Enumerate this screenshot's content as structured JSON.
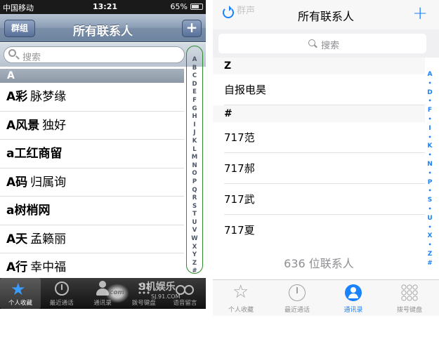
{
  "left_phone": {
    "status": {
      "carrier": "中国移动",
      "time": "13:21",
      "battery": "65%"
    },
    "nav": {
      "title": "所有联系人",
      "group_button": "群组",
      "add_button": "+"
    },
    "search": {
      "placeholder": "搜索"
    },
    "section_header": "A",
    "contacts": [
      {
        "first": "A彩",
        "last": "脉梦缘"
      },
      {
        "first": "A风景",
        "last": "独好"
      },
      {
        "first": "a工红商留",
        "last": ""
      },
      {
        "first": "A码",
        "last": "归属询"
      },
      {
        "first": "a树梢网",
        "last": ""
      },
      {
        "first": "A天",
        "last": "孟籁丽"
      },
      {
        "first": "A行",
        "last": "幸中福"
      }
    ],
    "index_letters": [
      "A",
      "B",
      "C",
      "D",
      "E",
      "F",
      "G",
      "H",
      "I",
      "J",
      "K",
      "L",
      "M",
      "N",
      "O",
      "P",
      "Q",
      "R",
      "S",
      "T",
      "U",
      "V",
      "W",
      "X",
      "Y",
      "Z",
      "#"
    ],
    "tabs": [
      {
        "label": "个人收藏",
        "icon": "star-icon",
        "active": true
      },
      {
        "label": "最近通话",
        "icon": "clock-icon",
        "active": false
      },
      {
        "label": "通讯录",
        "icon": "person-icon",
        "active": false
      },
      {
        "label": "拨号键盘",
        "icon": "keypad-icon",
        "active": false
      },
      {
        "label": "语音留言",
        "icon": "voicemail-icon",
        "active": false
      }
    ],
    "watermark": {
      "text": "9机娱乐",
      "url": "SJ.91.COM",
      "logo": "com"
    }
  },
  "right_phone": {
    "nav": {
      "title": "所有联系人",
      "ghost_text": "群声"
    },
    "search": {
      "placeholder": "搜索"
    },
    "sections": [
      {
        "header": "Z",
        "rows": [
          "自报电昊"
        ]
      },
      {
        "header": "#",
        "rows": [
          "717范",
          "717郝",
          "717武",
          "717夏"
        ]
      }
    ],
    "footer": "636 位联系人",
    "index": [
      "A",
      "•",
      "D",
      "•",
      "F",
      "•",
      "I",
      "•",
      "K",
      "•",
      "N",
      "•",
      "P",
      "•",
      "S",
      "•",
      "U",
      "•",
      "X",
      "•",
      "Z",
      "#"
    ],
    "tabs": [
      {
        "label": "个人收藏",
        "icon": "star-icon",
        "active": false
      },
      {
        "label": "最近通话",
        "icon": "clock-icon",
        "active": false
      },
      {
        "label": "通讯录",
        "icon": "person-icon",
        "active": true
      },
      {
        "label": "拨号键盘",
        "icon": "keypad-icon",
        "active": false
      }
    ]
  },
  "colors": {
    "ios7_accent": "#1a82fb",
    "index_outline": "#2d8a2d"
  }
}
